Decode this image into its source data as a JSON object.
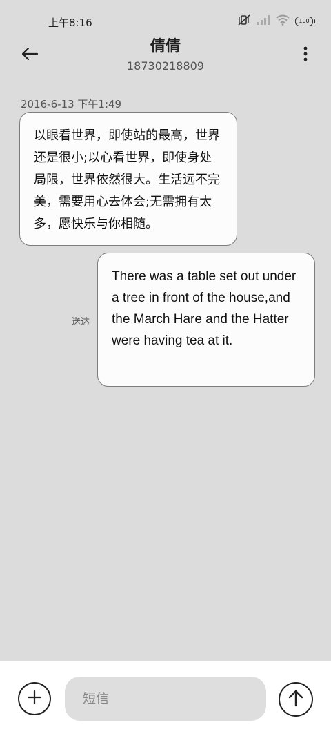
{
  "status_bar": {
    "time": "上午8:16",
    "battery": "100",
    "icons": [
      "mute-vibrate-icon",
      "signal-icon",
      "wifi-icon",
      "battery-icon"
    ]
  },
  "header": {
    "contact_name": "倩倩",
    "phone_number": "18730218809",
    "icons": [
      "back-arrow-icon",
      "more-vertical-icon"
    ]
  },
  "conversation": {
    "timestamp": "2016-6-13 下午1:49",
    "messages": [
      {
        "direction": "incoming",
        "text": "以眼看世界，即使站的最高，世界还是很小;以心看世界，即使身处局限，世界依然很大。生活远不完美，需要用心去体会;无需拥有太多，愿快乐与你相随。"
      },
      {
        "direction": "outgoing",
        "text": "There was a table set out under a tree in front of the house,and the March Hare and the Hatter were having tea at it.",
        "status": "送达"
      }
    ]
  },
  "composer": {
    "placeholder": "短信",
    "value": "",
    "icons": [
      "add-icon",
      "send-arrow-icon"
    ]
  },
  "colors": {
    "background": "#dcdcdc",
    "bubble": "#fdfcfc",
    "bubble_border": "#7d7d7d",
    "bottom_bar": "#ffffff",
    "input_bg": "#dedede"
  }
}
